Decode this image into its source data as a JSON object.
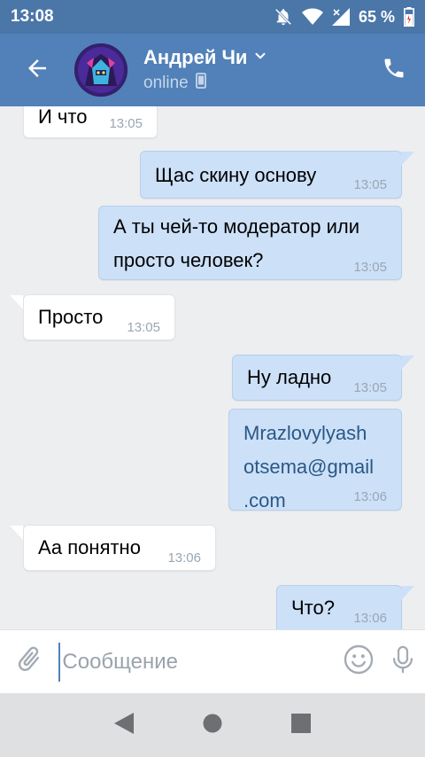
{
  "status_bar": {
    "time": "13:08",
    "battery": "65 %"
  },
  "header": {
    "contact_name": "Андрей Чи",
    "contact_status": "online",
    "icons": [
      "back-arrow-icon",
      "chevron-down-icon",
      "mobile-icon",
      "phone-icon"
    ]
  },
  "messages": [
    {
      "direction": "in",
      "text": "И что",
      "time": "13:05"
    },
    {
      "direction": "out",
      "text": "Щас скину основу",
      "time": "13:05"
    },
    {
      "direction": "out",
      "text": "А ты чей-то модератор или\nпросто человек?",
      "time": "13:05"
    },
    {
      "direction": "in",
      "text": "Просто",
      "time": "13:05"
    },
    {
      "direction": "out",
      "text": "Ну ладно",
      "time": "13:05"
    },
    {
      "direction": "out",
      "text": "Mrazlovylyash\notsema@gmail\n.com",
      "time": "13:06"
    },
    {
      "direction": "in",
      "text": "Аа понятно",
      "time": "13:06"
    },
    {
      "direction": "out",
      "text": "Что?",
      "time": "13:06"
    }
  ],
  "input": {
    "placeholder": "Сообщение",
    "value": ""
  },
  "colors": {
    "header_bg": "#5181b8",
    "status_bg": "#4a76a8",
    "outgoing_bubble": "#cce0f8",
    "incoming_bubble": "#ffffff",
    "chat_bg": "#edeef0"
  }
}
